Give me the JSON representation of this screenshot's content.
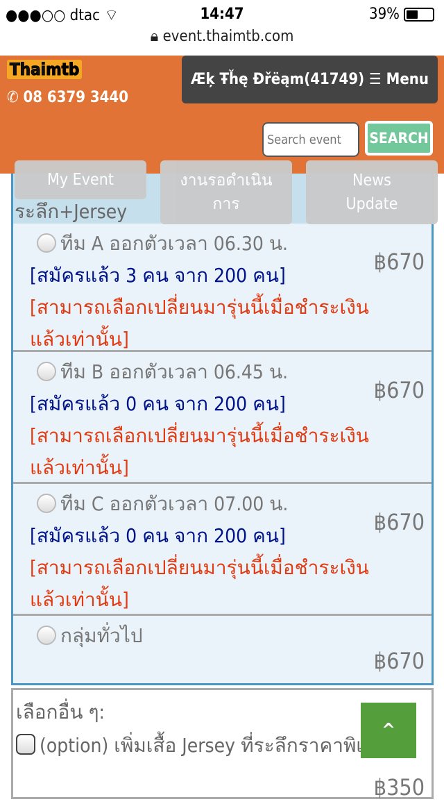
{
  "status_bar": {
    "signal": "●●●○○",
    "carrier": "dtac",
    "time": "14:47",
    "battery": "39%",
    "battery_level": 0.39
  },
  "browser": {
    "url": "event.thaimtb.com"
  },
  "header": {
    "logo": "Thaimtb.com",
    "phone": "08 6379 3440",
    "user_menu": "Æķ Ŧȟę Ðřëąm(41749) ☰ Menu",
    "search_placeholder": "Search event",
    "search_label": "SEARCH"
  },
  "nav": [
    {
      "label": "My Event"
    },
    {
      "label": "งานรอดำเนินการ"
    },
    {
      "label": "News Update"
    }
  ],
  "category_title": "ระลึก+Jersey",
  "options": [
    {
      "title": "ทีม A ออกตัวเวลา 06.30 น.",
      "registered": "[สมัครแล้ว 3 คน จาก 200 คน]",
      "note": "[สามารถเลือกเปลี่ยนมารุ่นนี้เมื่อชำระเงินแล้วเท่านั้น]",
      "price": "฿670"
    },
    {
      "title": "ทีม B ออกตัวเวลา 06.45 น.",
      "registered": "[สมัครแล้ว 0 คน จาก 200 คน]",
      "note": "[สามารถเลือกเปลี่ยนมารุ่นนี้เมื่อชำระเงินแล้วเท่านั้น]",
      "price": "฿670"
    },
    {
      "title": "ทีม C ออกตัวเวลา 07.00 น.",
      "registered": "[สมัครแล้ว 0 คน จาก 200 คน]",
      "note": "[สามารถเลือกเปลี่ยนมารุ่นนี้เมื่อชำระเงินแล้วเท่านั้น]",
      "price": "฿670"
    },
    {
      "title": "กลุ่มทั่วไป",
      "price": "฿670"
    }
  ],
  "extras": {
    "label": "เลือกอื่น ๆ:",
    "item": "(option) เพิ่มเสื้อ Jersey ที่ระลึกราคาพิเศษ",
    "price": "฿350"
  },
  "scroll_top": "^"
}
